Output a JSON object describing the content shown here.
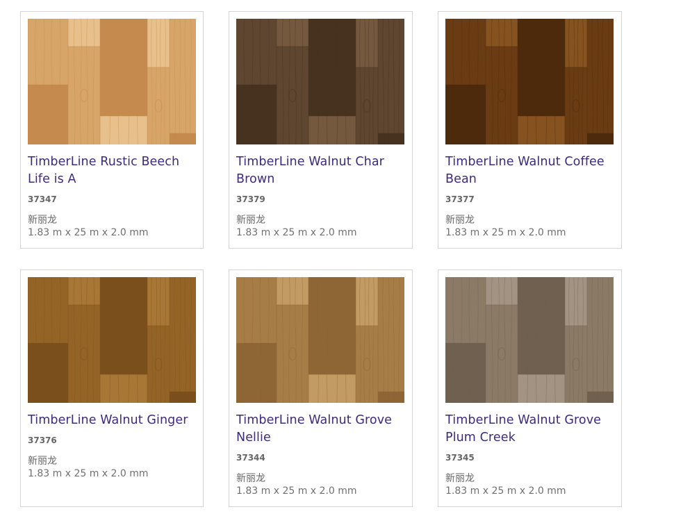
{
  "products": [
    {
      "name": "TimberLine Rustic Beech Life is A",
      "code": "37347",
      "brand": "新丽龙",
      "dimensions": "1.83 m x 25 m x 2.0 mm",
      "colors": {
        "base": "#d8a568",
        "light": "#e8c08b",
        "dark": "#c48a4e"
      }
    },
    {
      "name": "TimberLine Walnut Char Brown",
      "code": "37379",
      "brand": "新丽龙",
      "dimensions": "1.83 m x 25 m x 2.0 mm",
      "colors": {
        "base": "#5e4630",
        "light": "#75593e",
        "dark": "#46321f"
      }
    },
    {
      "name": "TimberLine Walnut Coffee Bean",
      "code": "37377",
      "brand": "新丽龙",
      "dimensions": "1.83 m x 25 m x 2.0 mm",
      "colors": {
        "base": "#6b3c14",
        "light": "#86521f",
        "dark": "#4e2a0c"
      }
    },
    {
      "name": "TimberLine Walnut Ginger",
      "code": "37376",
      "brand": "新丽龙",
      "dimensions": "1.83 m x 25 m x 2.0 mm",
      "colors": {
        "base": "#946427",
        "light": "#a87736",
        "dark": "#7b4f1c"
      }
    },
    {
      "name": "TimberLine Walnut Grove Nellie",
      "code": "37344",
      "brand": "新丽龙",
      "dimensions": "1.83 m x 25 m x 2.0 mm",
      "colors": {
        "base": "#a77d47",
        "light": "#c29a63",
        "dark": "#8e6534"
      }
    },
    {
      "name": "TimberLine Walnut Grove Plum Creek",
      "code": "37345",
      "brand": "新丽龙",
      "dimensions": "1.83 m x 25 m x 2.0 mm",
      "colors": {
        "base": "#8b7a66",
        "light": "#a39382",
        "dark": "#6f604f"
      }
    }
  ]
}
